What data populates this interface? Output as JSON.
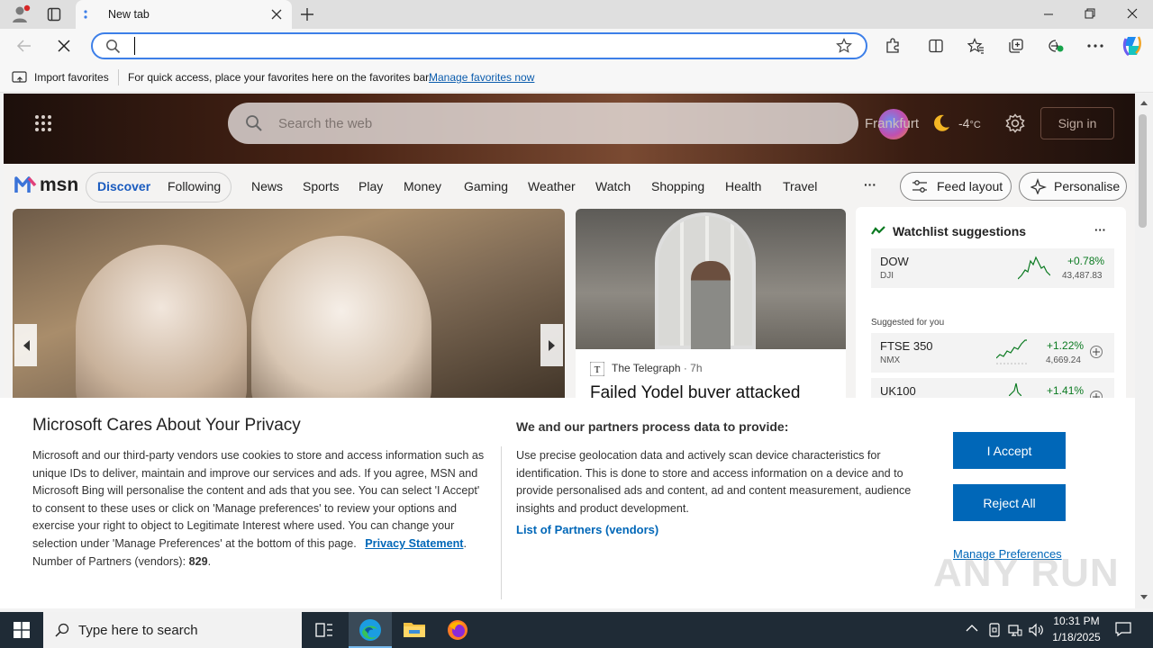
{
  "browser": {
    "tab_title": "New tab",
    "address_value": "",
    "favorites_bar": {
      "import_label": "Import favorites",
      "hint": "For quick access, place your favorites here on the favorites bar.",
      "manage_link": "Manage favorites now"
    }
  },
  "msn": {
    "search_placeholder": "Search the web",
    "location": "Frankfurt",
    "temperature": "-4",
    "temp_unit": "°C",
    "sign_in": "Sign in",
    "logo": "msn",
    "pills": [
      "Discover",
      "Following"
    ],
    "nav": [
      "News",
      "Sports",
      "Play",
      "Money",
      "Gaming",
      "Weather",
      "Watch",
      "Shopping",
      "Health",
      "Travel"
    ],
    "more": "···",
    "feed_layout": "Feed layout",
    "personalise": "Personalise",
    "story2": {
      "source": "The Telegraph",
      "age": "· 7h",
      "headline": "Failed Yodel buyer attacked"
    },
    "watchlist": {
      "title": "Watchlist suggestions",
      "more": "···",
      "dow": {
        "name": "DOW",
        "sub": "DJI",
        "change": "+0.78%",
        "value": "43,487.83"
      },
      "suggested_label": "Suggested for you",
      "ftse": {
        "name": "FTSE 350",
        "sub": "NMX",
        "change": "+1.22%",
        "value": "4,669.24"
      },
      "uk100": {
        "name": "UK100",
        "change": "+1.41%"
      }
    }
  },
  "privacy": {
    "title": "Microsoft Cares About Your Privacy",
    "body": "Microsoft and our third-party vendors use cookies to store and access information such as unique IDs to deliver, maintain and improve our services and ads. If you agree, MSN and Microsoft Bing will personalise the content and ads that you see. You can select 'I Accept' to consent to these uses or click on 'Manage preferences' to review your options and exercise your right to object to Legitimate Interest where used.  You can change your selection under 'Manage Preferences' at the bottom of this page.",
    "privacy_link": "Privacy Statement",
    "partners_label": "Number of Partners (vendors):",
    "partners_count": "829",
    "right_heading": "We and our partners process data to provide:",
    "right_body": "Use precise geolocation data and actively scan device characteristics for identification. This is done to store and access information on a device and to provide personalised ads and content, ad and content measurement, audience insights and product development.",
    "list_link": "List of Partners (vendors)",
    "accept": "I Accept",
    "reject": "Reject All",
    "manage": "Manage Preferences"
  },
  "taskbar": {
    "search_placeholder": "Type here to search",
    "time": "10:31 PM",
    "date": "1/18/2025"
  },
  "watermark": "ANY RUN",
  "colors": {
    "accent": "#0067b8",
    "address_border": "#3d7fe8",
    "stock_green": "#0b7a21"
  }
}
